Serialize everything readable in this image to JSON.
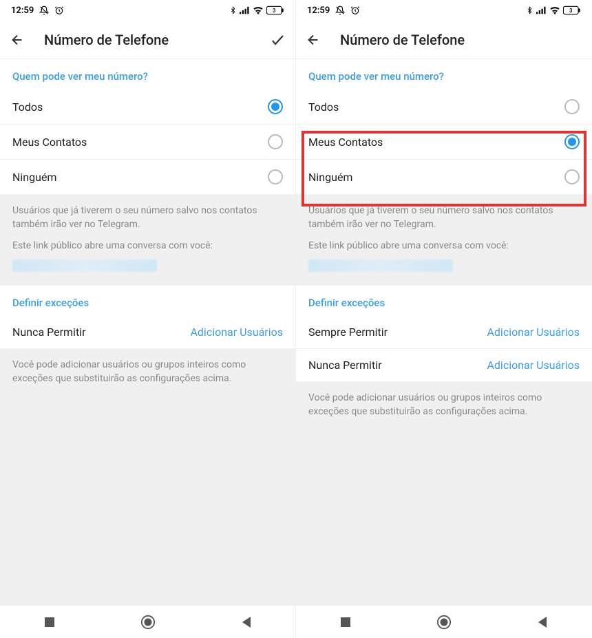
{
  "statusBar": {
    "time": "12:59",
    "batteryLevel": "3"
  },
  "header": {
    "title": "Número de Telefone"
  },
  "section1": {
    "header": "Quem pode ver meu número?",
    "options": {
      "everyone": "Todos",
      "contacts": "Meus Contatos",
      "nobody": "Ninguém"
    }
  },
  "helpText": {
    "line1": "Usuários que já tiverem o seu número salvo nos contatos também irão ver no Telegram.",
    "line2": "Este link público abre uma conversa com você:"
  },
  "section2": {
    "header": "Definir exceções",
    "alwaysAllow": "Sempre Permitir",
    "neverAllow": "Nunca Permitir",
    "addUsers": "Adicionar Usuários"
  },
  "footerHelp": "Você pode adicionar usuários ou grupos inteiros como exceções que substituirão as configurações acima."
}
